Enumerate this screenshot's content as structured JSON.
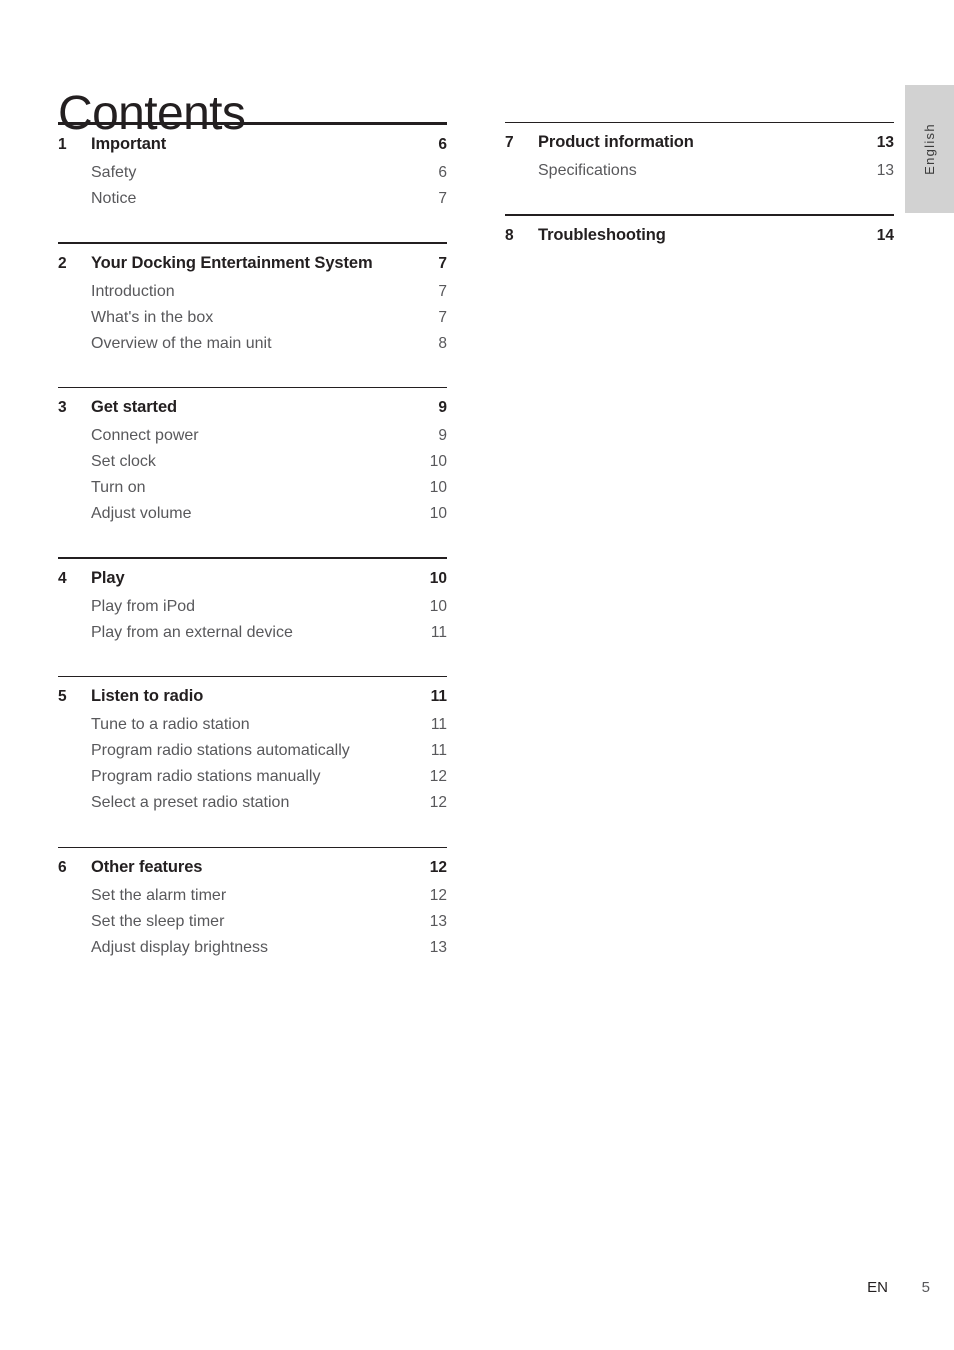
{
  "document": {
    "title": "Contents",
    "language_tab": "English",
    "footer": {
      "language_code": "EN",
      "page_number": "5"
    }
  },
  "colors": {
    "heading": "#231f20",
    "subentry": "#58585b",
    "rule": "#231f20",
    "tab_background": "#d2d2d2"
  },
  "toc": {
    "left_column": [
      {
        "rule": "thick",
        "number": "1",
        "title": "Important",
        "page": "6",
        "subentries": [
          {
            "title": "Safety",
            "page": "6"
          },
          {
            "title": "Notice",
            "page": "7"
          }
        ]
      },
      {
        "rule": "thin",
        "number": "2",
        "title": "Your Docking Entertainment System",
        "page": "7",
        "subentries": [
          {
            "title": "Introduction",
            "page": "7"
          },
          {
            "title": "What's in the box",
            "page": "7"
          },
          {
            "title": "Overview of the main unit",
            "page": "8"
          }
        ]
      },
      {
        "rule": "thin",
        "number": "3",
        "title": "Get started",
        "page": "9",
        "subentries": [
          {
            "title": "Connect power",
            "page": "9"
          },
          {
            "title": "Set clock",
            "page": "10"
          },
          {
            "title": "Turn on",
            "page": "10"
          },
          {
            "title": "Adjust volume",
            "page": "10"
          }
        ]
      },
      {
        "rule": "thin",
        "number": "4",
        "title": "Play",
        "page": "10",
        "subentries": [
          {
            "title": "Play from iPod",
            "page": "10"
          },
          {
            "title": "Play from an external device",
            "page": "11"
          }
        ]
      },
      {
        "rule": "thin",
        "number": "5",
        "title": "Listen to radio",
        "page": "11",
        "subentries": [
          {
            "title": "Tune to a radio station",
            "page": "11"
          },
          {
            "title": "Program radio stations automatically",
            "page": "11"
          },
          {
            "title": "Program radio stations manually",
            "page": "12"
          },
          {
            "title": "Select a preset radio station",
            "page": "12"
          }
        ]
      },
      {
        "rule": "thin",
        "number": "6",
        "title": "Other features",
        "page": "12",
        "subentries": [
          {
            "title": "Set the alarm timer",
            "page": "12"
          },
          {
            "title": "Set the sleep timer",
            "page": "13"
          },
          {
            "title": "Adjust display brightness",
            "page": "13"
          }
        ]
      }
    ],
    "right_column": [
      {
        "rule": "thin",
        "number": "7",
        "title": "Product information",
        "page": "13",
        "subentries": [
          {
            "title": "Specifications",
            "page": "13"
          }
        ]
      },
      {
        "rule": "thin",
        "number": "8",
        "title": "Troubleshooting",
        "page": "14",
        "subentries": []
      }
    ]
  }
}
